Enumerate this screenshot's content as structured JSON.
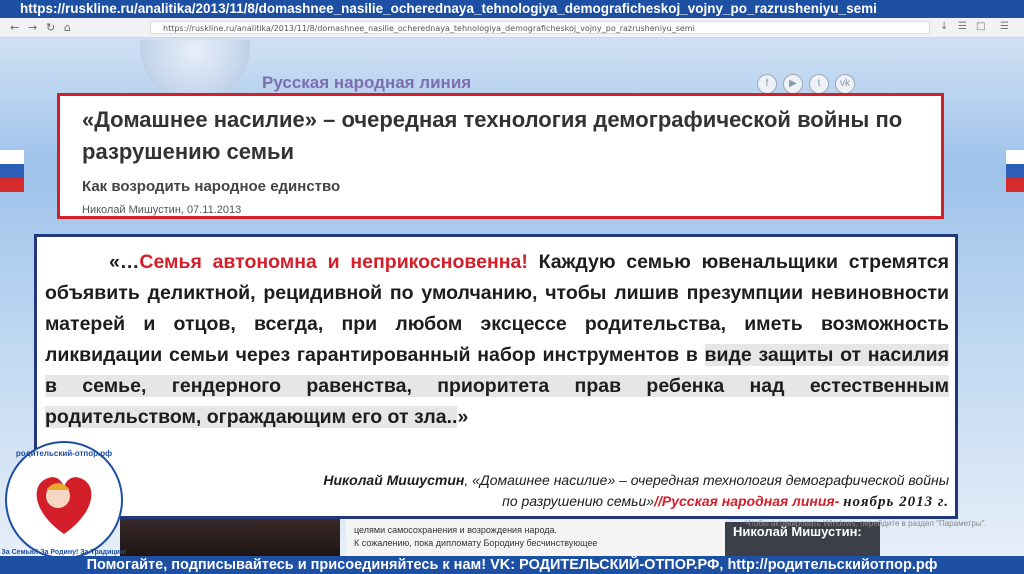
{
  "top_banner": {
    "url": "https://ruskline.ru/analitika/2013/11/8/domashnee_nasilie_ocherednaya_tehnologiya_demograficheskoj_vojny_po_razrusheniyu_semi"
  },
  "browser": {
    "address": "https://ruskline.ru/analitika/2013/11/8/domashnee_nasilie_ocherednaya_tehnologiya_demograficheskoj_vojny_po_razrusheniyu_semi"
  },
  "site": {
    "name": "Русская народная линия"
  },
  "article": {
    "title": "«Домашнее насилие» – очередная технология демографической войны по разрушению семьи",
    "subtitle": "Как возродить народное единство",
    "author_date": "Николай Мишустин, 07.11.2013"
  },
  "quote": {
    "open": "«…",
    "red_part": "Семья автономна и неприкосновенна!",
    "part1": " Каждую семью ювенальщики стремятся объявить деликтной, рецидивной по умолчанию, чтобы лишив презумпции невиновности матерей и отцов, всегда, при любом эксцессе родительства, иметь возможность ликвидации семьи через гарантированный набор инструментов в ",
    "highlight": "виде защиты от насилия в семье, гендерного равенства, приоритета прав ребенка над естественным родительством, ограждающим его от зла..",
    "close": "»"
  },
  "attribution": {
    "author": "Николай Мишустин",
    "line1_rest": ", «Домашнее насилие» – очередная технология демографической войны",
    "line2_start": "по разрушению семьи»",
    "source": "//Русская народная линия-",
    "date": "ноябрь 2013 г."
  },
  "lower": {
    "text1": "целями самосохранения и возрождения народа.",
    "text2": "К сожалению, пока дипломату Бородину бесчинствующее",
    "windows_notice": "Чтобы активировать Windows, перейдите в раздел \"Параметры\".",
    "name": "Николай Мишустин:"
  },
  "logo": {
    "text": "родительский-отпор.рф · За Семью! За Родину! За Традиции!"
  },
  "bottom_banner": {
    "text": "Помогайте, подписывайтесь и присоединяйтесь к нам! VK: РОДИТЕЛЬСКИЙ-ОТПОР.РФ, http://родительскийотпор.рф"
  },
  "colors": {
    "banner": "#1d4fa3",
    "title_border": "#d31f2a",
    "quote_border": "#22387a",
    "accent_red": "#d31f2a"
  }
}
